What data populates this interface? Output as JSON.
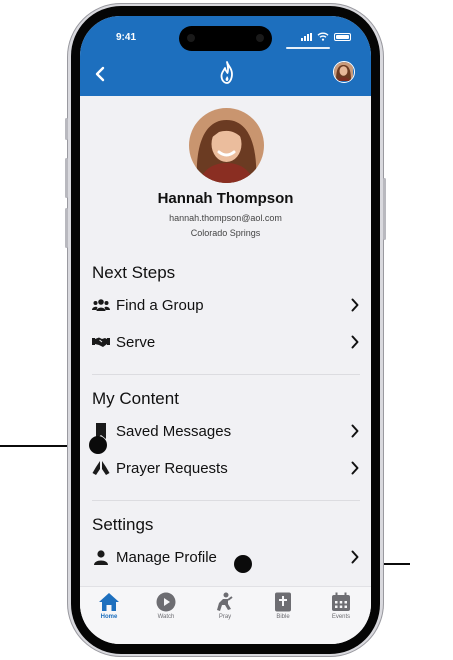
{
  "status_bar": {
    "time": "9:41"
  },
  "header": {
    "back_icon": "chevron-left-icon",
    "logo_icon": "flame-logo-icon",
    "avatar": "user-avatar"
  },
  "profile": {
    "name": "Hannah Thompson",
    "email": "hannah.thompson@aol.com",
    "location": "Colorado Springs"
  },
  "sections": {
    "next_steps": {
      "title": "Next Steps",
      "items": [
        {
          "label": "Find a Group",
          "icon": "users-icon"
        },
        {
          "label": "Serve",
          "icon": "handshake-icon"
        }
      ]
    },
    "my_content": {
      "title": "My Content",
      "items": [
        {
          "label": "Saved Messages",
          "icon": "bookmark-icon"
        },
        {
          "label": "Prayer Requests",
          "icon": "praying-hands-icon"
        }
      ]
    },
    "settings": {
      "title": "Settings",
      "items": [
        {
          "label": "Manage Profile",
          "icon": "user-icon"
        }
      ]
    }
  },
  "tabbar": {
    "active": "Home",
    "tabs": [
      {
        "label": "Home",
        "icon": "home-icon"
      },
      {
        "label": "Watch",
        "icon": "play-circle-icon"
      },
      {
        "label": "Pray",
        "icon": "praying-person-icon"
      },
      {
        "label": "Bible",
        "icon": "bible-icon"
      },
      {
        "label": "Events",
        "icon": "calendar-icon"
      }
    ]
  },
  "colors": {
    "brand_blue": "#1d6fbe",
    "screen_bg": "#f1f1f4",
    "callout": "#0b0b0b"
  }
}
